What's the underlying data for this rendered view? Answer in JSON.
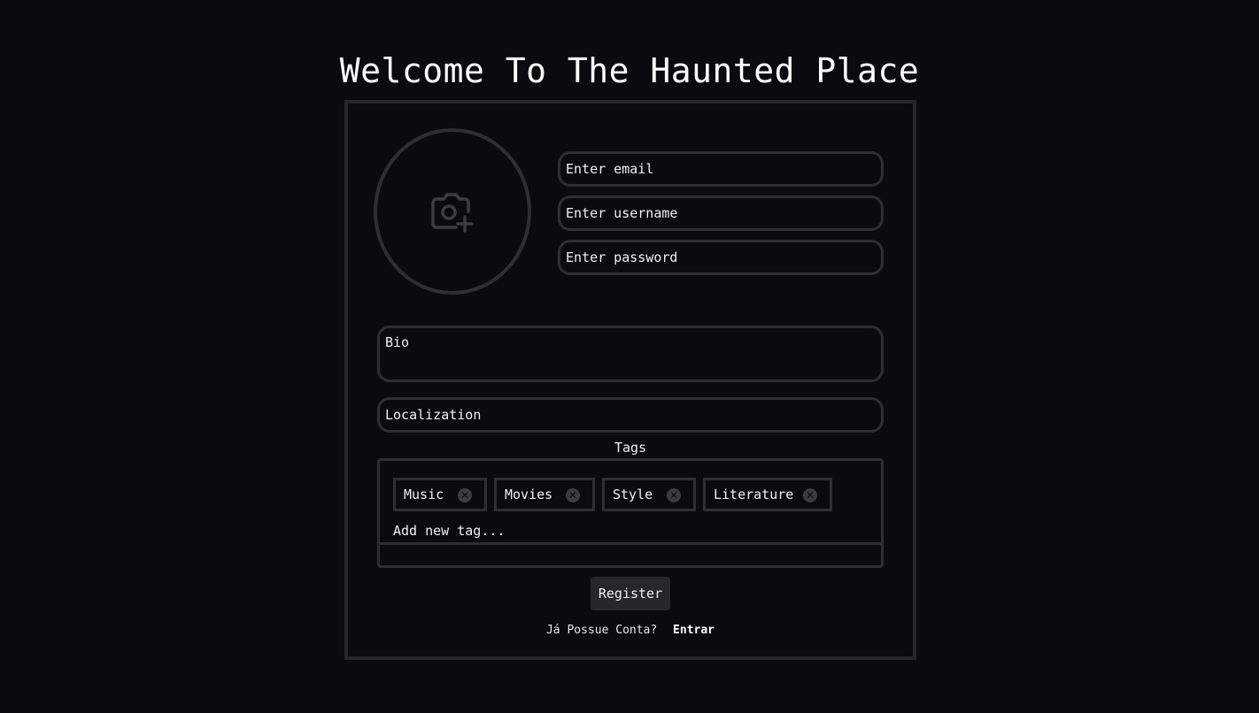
{
  "header": {
    "title": "Welcome To The Haunted Place"
  },
  "form": {
    "avatar_icon": "camera-plus-icon",
    "email_placeholder": "Enter email",
    "username_placeholder": "Enter username",
    "password_placeholder": "Enter password",
    "bio_placeholder": "Bio",
    "localization_placeholder": "Localization",
    "tags_label": "Tags",
    "tags": [
      {
        "label": "Music"
      },
      {
        "label": "Movies"
      },
      {
        "label": "Style"
      },
      {
        "label": "Literature"
      }
    ],
    "tag_remove_icon": "x-circle-icon",
    "tag_input_placeholder": "Add new tag...",
    "register_label": "Register",
    "login_prompt": "Já Possue Conta?",
    "login_link": "Entrar"
  },
  "colors": {
    "background": "#0a0b0e",
    "border": "#2c2f34",
    "button": "#24272c",
    "text": "#f0f0f0"
  }
}
